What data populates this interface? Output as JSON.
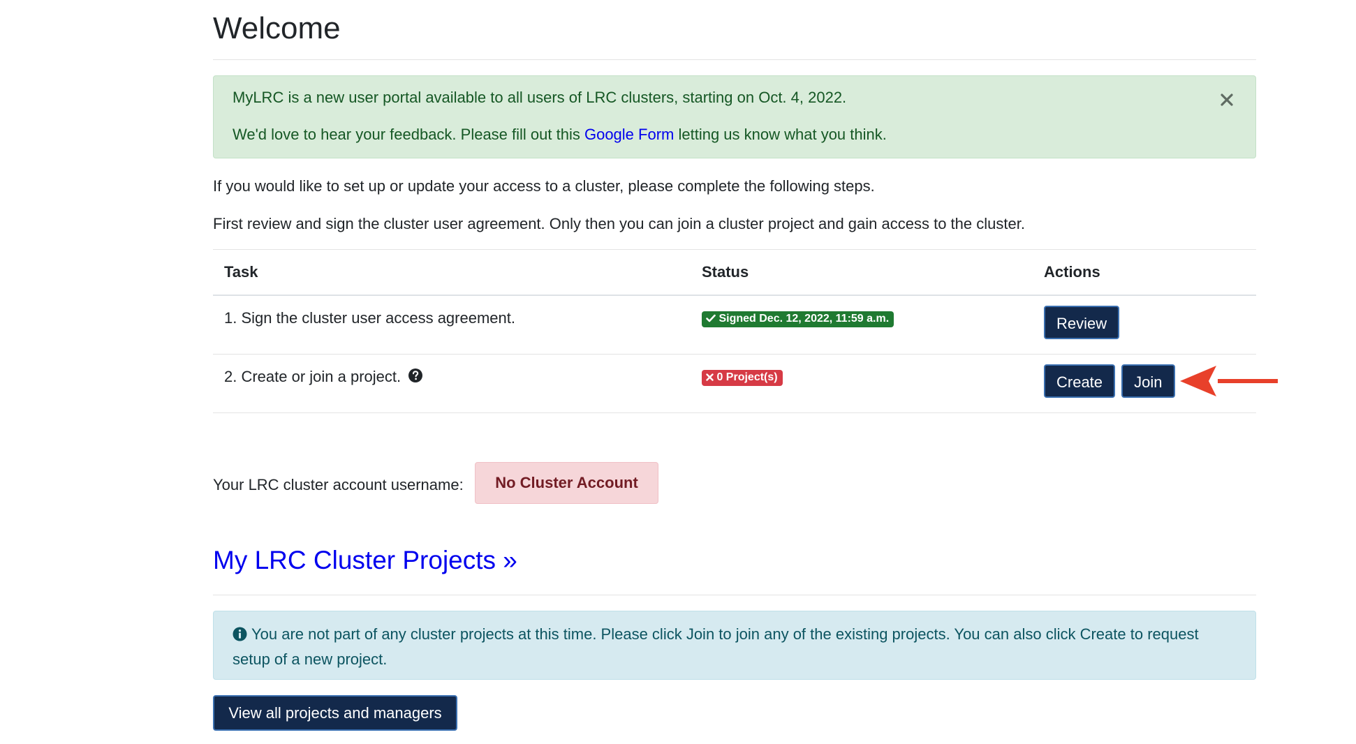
{
  "page": {
    "title": "Welcome"
  },
  "announcement": {
    "line1": "MyLRC is a new user portal available to all users of LRC clusters, starting on Oct. 4, 2022.",
    "line2_before": "We'd love to hear your feedback. Please fill out this ",
    "line2_link": "Google Form",
    "line2_after": " letting us know what you think.",
    "close_icon": "close-icon"
  },
  "intro": {
    "p1": "If you would like to set up or update your access to a cluster, please complete the following steps.",
    "p2": "First review and sign the cluster user agreement. Only then you can join a cluster project and gain access to the cluster."
  },
  "tasks_table": {
    "headers": [
      "Task",
      "Status",
      "Actions"
    ],
    "rows": [
      {
        "task": "1. Sign the cluster user access agreement.",
        "status": "Signed Dec. 12, 2022, 11:59 a.m.",
        "status_type": "success",
        "actions": [
          "Review"
        ]
      },
      {
        "task": "2. Create or join a project.",
        "status": "0 Project(s)",
        "status_type": "danger",
        "actions": [
          "Create",
          "Join"
        ]
      }
    ]
  },
  "username": {
    "label": "Your LRC cluster account username:",
    "value": "No Cluster Account"
  },
  "projects": {
    "heading": "My LRC Cluster Projects »",
    "info": "You are not part of any cluster projects at this time. Please click Join to join any of the existing projects. You can also click Create to request setup of a new project.",
    "view_all_label": "View all projects and managers"
  },
  "colors": {
    "button_bg": "#13294b",
    "success_badge": "#1f7a31",
    "danger_badge": "#d63a45",
    "link": "#0000ee",
    "annotation_arrow": "#e8402a"
  }
}
